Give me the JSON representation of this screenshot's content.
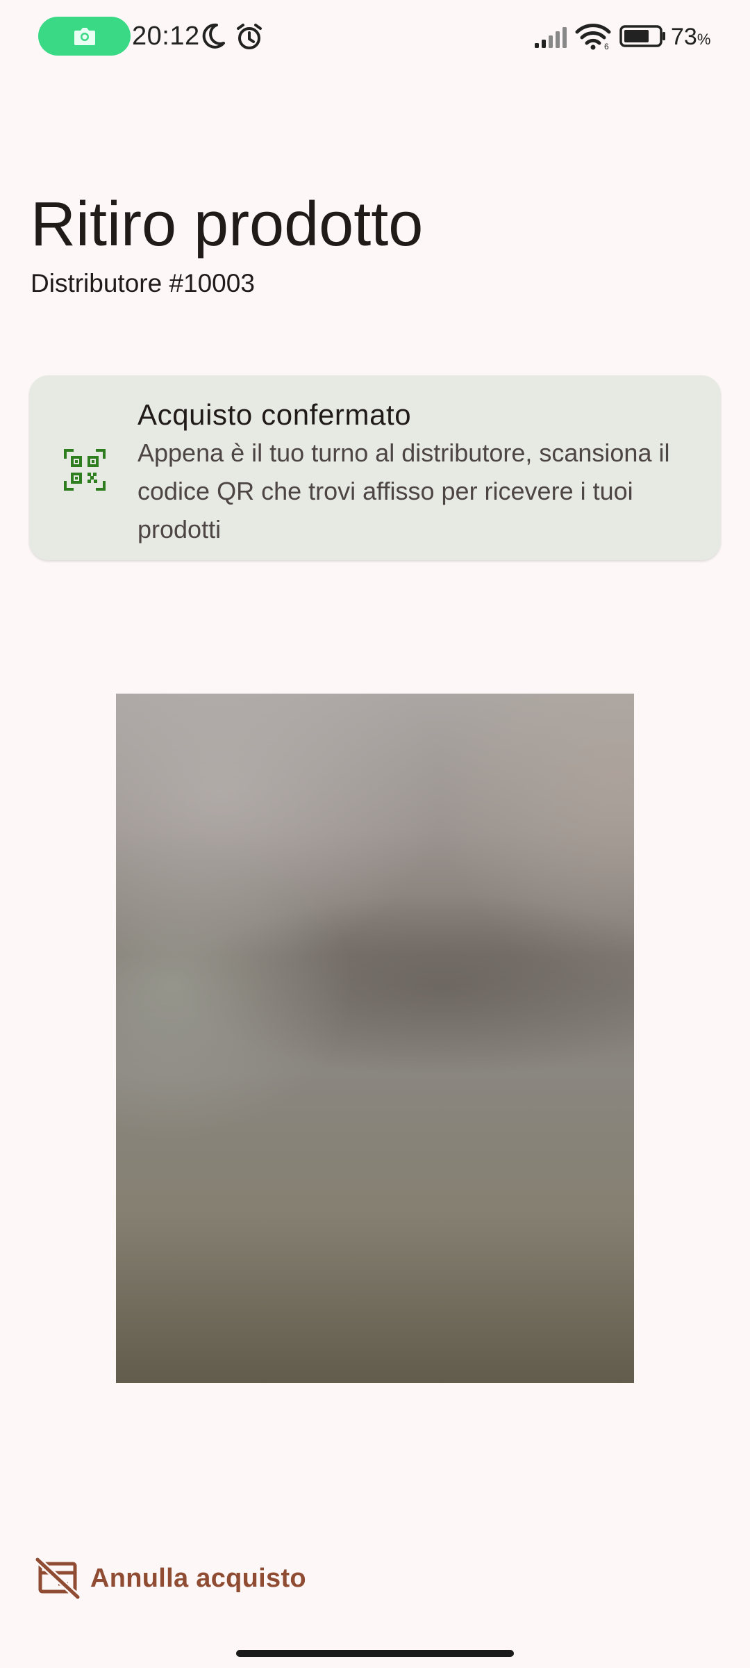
{
  "status_bar": {
    "time": "20:12",
    "battery_percent": "73",
    "battery_unit": "%",
    "battery_level": 0.73,
    "icons": [
      "camera-icon",
      "moon-icon",
      "alarm-icon",
      "signal-icon",
      "wifi-icon",
      "battery-icon"
    ],
    "camera_pill_color": "#3ad986"
  },
  "header": {
    "title": "Ritiro prodotto",
    "subtitle": "Distributore #10003"
  },
  "info_card": {
    "icon": "qr-code-scanner-icon",
    "title": "Acquisto confermato",
    "body": "Appena è il tuo turno al distributore, scansiona il codice QR che trovi affisso per ricevere i tuoi prodotti",
    "background_color": "#e6eae2",
    "icon_color": "#2e7d1f"
  },
  "camera_preview": {
    "icon": "camera-viewfinder"
  },
  "actions": {
    "cancel_label": "Annulla acquisto",
    "cancel_icon": "card-off-icon",
    "cancel_color": "#8f4c33"
  }
}
